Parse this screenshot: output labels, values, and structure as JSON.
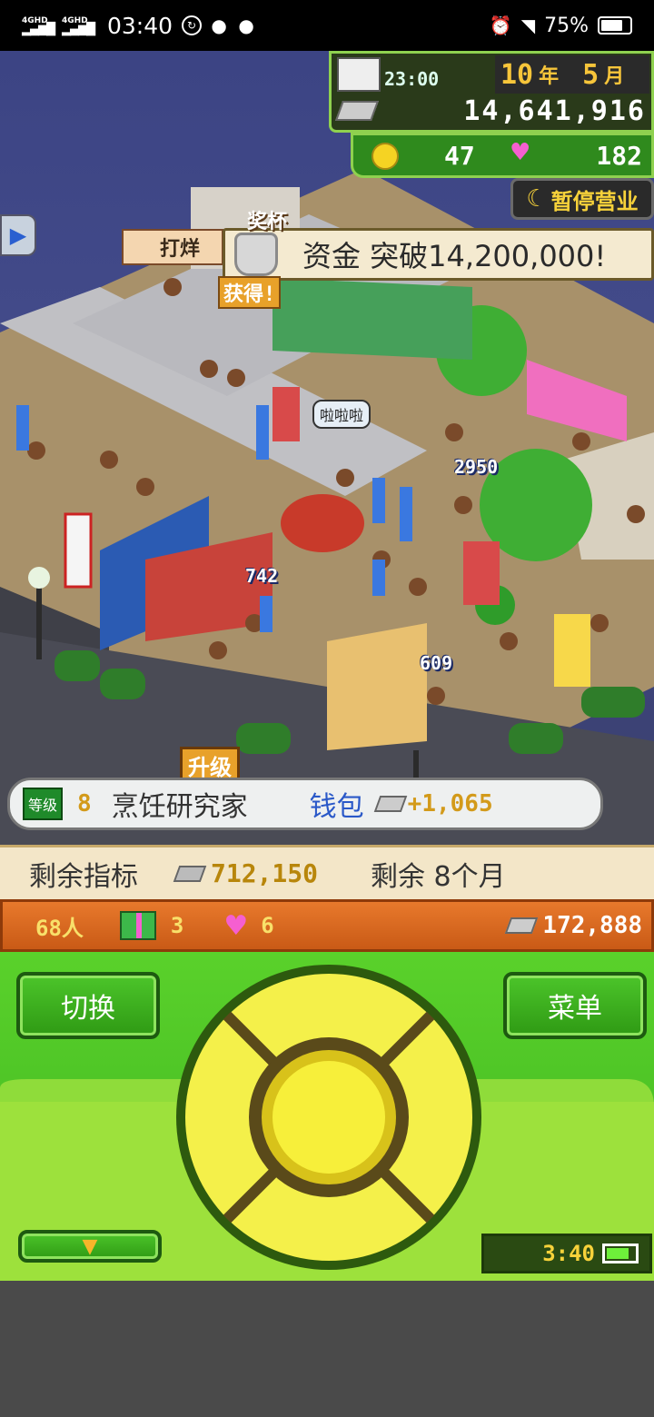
{
  "status_bar": {
    "signal1": "4GHD",
    "signal2": "4GHD",
    "time": "03:40",
    "battery_percent": "75%",
    "battery_level": 0.75
  },
  "hud": {
    "clock": "23:00",
    "year_value": "10",
    "year_unit": "年",
    "month_value": "5",
    "month_unit": "月",
    "money": "14,641,916",
    "coins": "47",
    "hearts": "182",
    "pause_button": "暂停营业"
  },
  "notice": {
    "text": "资金 突破14,200,000!",
    "trophy_title": "奖杯",
    "trophy_caption": "获得!"
  },
  "scene": {
    "worker_label": "打烊",
    "speech_bubble": "啦啦啦",
    "num_tags": [
      "2950",
      "742",
      "609"
    ],
    "upgrade_label": "升级"
  },
  "rank": {
    "level_label": "等级",
    "level_value": "8",
    "title": "烹饪研究家",
    "wallet_label": "钱包",
    "wallet_amount": "+1,065"
  },
  "strip1": {
    "target_label": "剩余指标",
    "target_value": "712,150",
    "remaining": "剩余 8个月"
  },
  "strip2": {
    "people": "68人",
    "gifts": "3",
    "hearts": "6",
    "money": "172,888"
  },
  "controller": {
    "switch_button": "切换",
    "menu_button": "菜单",
    "device_clock": "3:40",
    "device_battery_level": 0.8
  },
  "colors": {
    "accent_green": "#3fb520",
    "orange_strip": "#e8792c",
    "hud_dark": "#2a3a1a",
    "pad_yellow": "#f4f04a"
  }
}
